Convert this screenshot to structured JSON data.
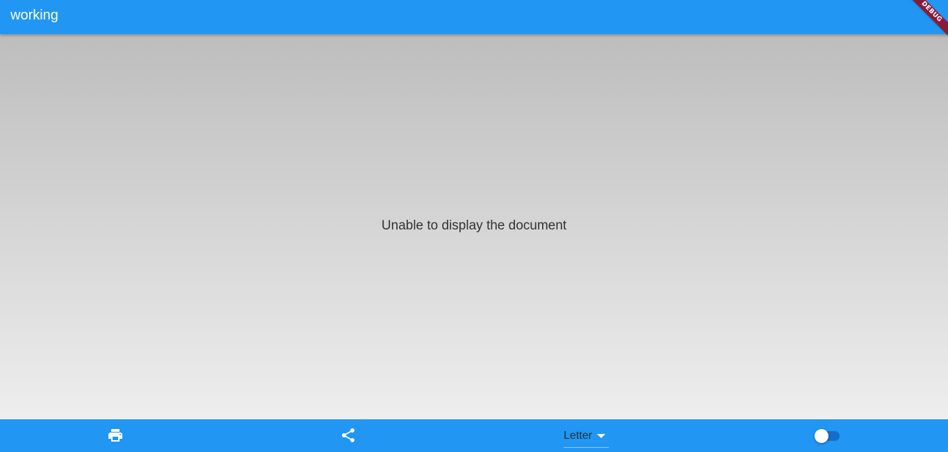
{
  "appbar": {
    "title": "working"
  },
  "debug_banner": {
    "label": "DEBUG",
    "color": "#8b1a3a"
  },
  "content": {
    "message": "Unable to display the document"
  },
  "bottombar": {
    "print_icon": "print-icon",
    "share_icon": "share-icon",
    "page_format": {
      "selected": "Letter",
      "icon": "arrow-drop-down-icon"
    },
    "toggle": {
      "on": false
    }
  },
  "colors": {
    "primary": "#2196f3",
    "gradient_top": "#bdbdbd",
    "gradient_bottom": "#eeeeee",
    "text": "#333333"
  }
}
